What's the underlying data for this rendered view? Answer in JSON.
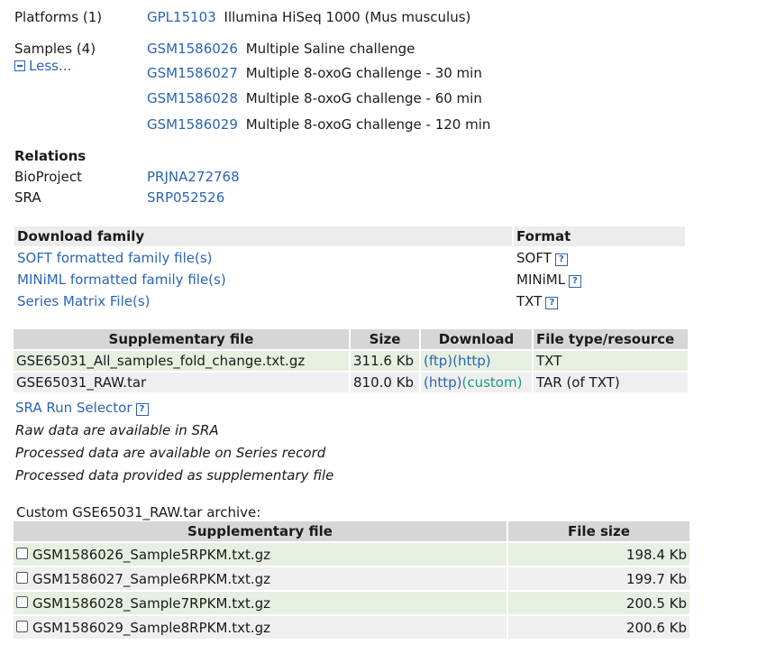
{
  "platforms": {
    "label": "Platforms (1)",
    "id": "GPL15103",
    "desc": "Illumina HiSeq 1000 (Mus musculus)"
  },
  "samples": {
    "label": "Samples (4)",
    "less_label": "Less...",
    "items": [
      {
        "id": "GSM1586026",
        "desc": "Multiple Saline challenge"
      },
      {
        "id": "GSM1586027",
        "desc": "Multiple 8-oxoG challenge - 30 min"
      },
      {
        "id": "GSM1586028",
        "desc": "Multiple 8-oxoG challenge - 60 min"
      },
      {
        "id": "GSM1586029",
        "desc": "Multiple 8-oxoG challenge - 120 min"
      }
    ]
  },
  "relations": {
    "title": "Relations",
    "bioproject_label": "BioProject",
    "bioproject_value": "PRJNA272768",
    "sra_label": "SRA",
    "sra_value": "SRP052526"
  },
  "download_family": {
    "header": "Download family",
    "format_header": "Format",
    "rows": [
      {
        "name": "SOFT formatted family file(s)",
        "format": "SOFT"
      },
      {
        "name": "MINiML formatted family file(s)",
        "format": "MINiML"
      },
      {
        "name": "Series Matrix File(s)",
        "format": "TXT"
      }
    ],
    "help_glyph": "?"
  },
  "supplementary": {
    "headers": [
      "Supplementary file",
      "Size",
      "Download",
      "File type/resource"
    ],
    "rows": [
      {
        "file": "GSE65031_All_samples_fold_change.txt.gz",
        "size": "311.6 Kb",
        "dl1": "(ftp)",
        "dl2": "(http)",
        "type": "TXT"
      },
      {
        "file": "GSE65031_RAW.tar",
        "size": "810.0 Kb",
        "dl1": "(http)",
        "dl2": "(custom)",
        "type": "TAR (of TXT)"
      }
    ],
    "sra_selector": "SRA Run Selector",
    "notes": [
      "Raw data are available in SRA",
      "Processed data are available on Series record",
      "Processed data provided as supplementary file"
    ]
  },
  "custom_archive": {
    "title": "Custom GSE65031_RAW.tar archive:",
    "headers": [
      "Supplementary file",
      "File size"
    ],
    "rows": [
      {
        "file": "GSM1586026_Sample5RPKM.txt.gz",
        "size": "198.4 Kb",
        "checked": false
      },
      {
        "file": "GSM1586027_Sample6RPKM.txt.gz",
        "size": "199.7 Kb",
        "checked": false
      },
      {
        "file": "GSM1586028_Sample7RPKM.txt.gz",
        "size": "200.5 Kb",
        "checked": false
      },
      {
        "file": "GSM1586029_Sample8RPKM.txt.gz",
        "size": "200.6 Kb",
        "checked": false
      }
    ]
  },
  "colors": {
    "link": "#2a64b4",
    "link_alt": "#1a9a88",
    "row_green": "#e6efe0",
    "row_gray": "#efefef",
    "header_gray": "#d6d6d6"
  }
}
